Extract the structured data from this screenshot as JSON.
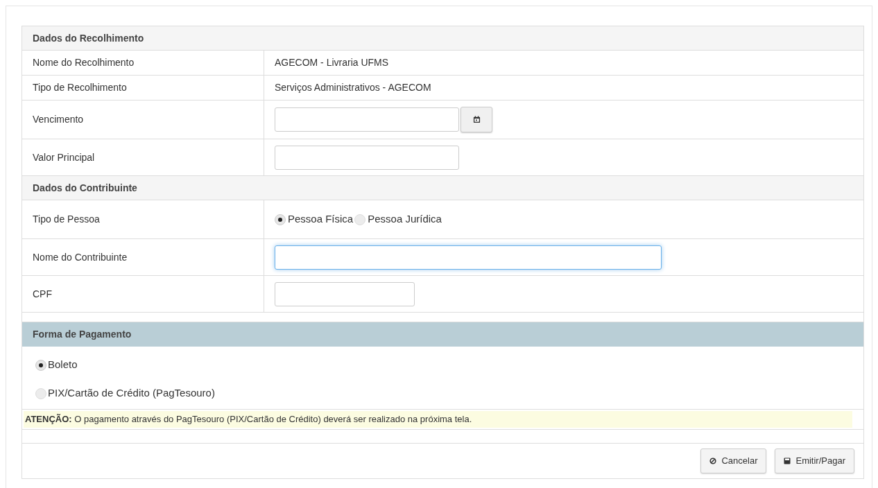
{
  "sections": [
    {
      "title": "Dados do Recolhimento",
      "rows": [
        {
          "kind": "text",
          "label": "Nome do Recolhimento",
          "value": "AGECOM - Livraria UFMS"
        },
        {
          "kind": "text",
          "label": "Tipo de Recolhimento",
          "value": "Serviços Administrativos - AGECOM"
        },
        {
          "kind": "date",
          "label": "Vencimento",
          "focused": false
        },
        {
          "kind": "input",
          "label": "Valor Principal",
          "focused": false
        }
      ]
    },
    {
      "title": "Dados do Contribuinte",
      "rows": [
        {
          "kind": "radio",
          "label": "Tipo de Pessoa",
          "options": [
            {
              "label": "Pessoa Física",
              "selected": true
            },
            {
              "label": "Pessoa Jurídica",
              "selected": false
            }
          ]
        },
        {
          "kind": "wideinput",
          "label": "Nome do Contribuinte",
          "focused": true
        },
        {
          "kind": "shortinput",
          "label": "CPF",
          "focused": false
        }
      ]
    }
  ],
  "payment": {
    "title": "Forma de Pagamento",
    "options": [
      {
        "label": "Boleto",
        "selected": true
      },
      {
        "label": "PIX/Cartão de Crédito (PagTesouro)",
        "selected": false
      }
    ],
    "notice": "**ATENÇÃO:** O pagamento através do PagTesouro (PIX/Cartão de Crédito) deverá ser realizado na próxima tela."
  },
  "buttons": [
    {
      "kind": "cancel",
      "label": "Cancelar"
    },
    {
      "kind": "submit",
      "label": "Emitir/Pagar"
    }
  ]
}
